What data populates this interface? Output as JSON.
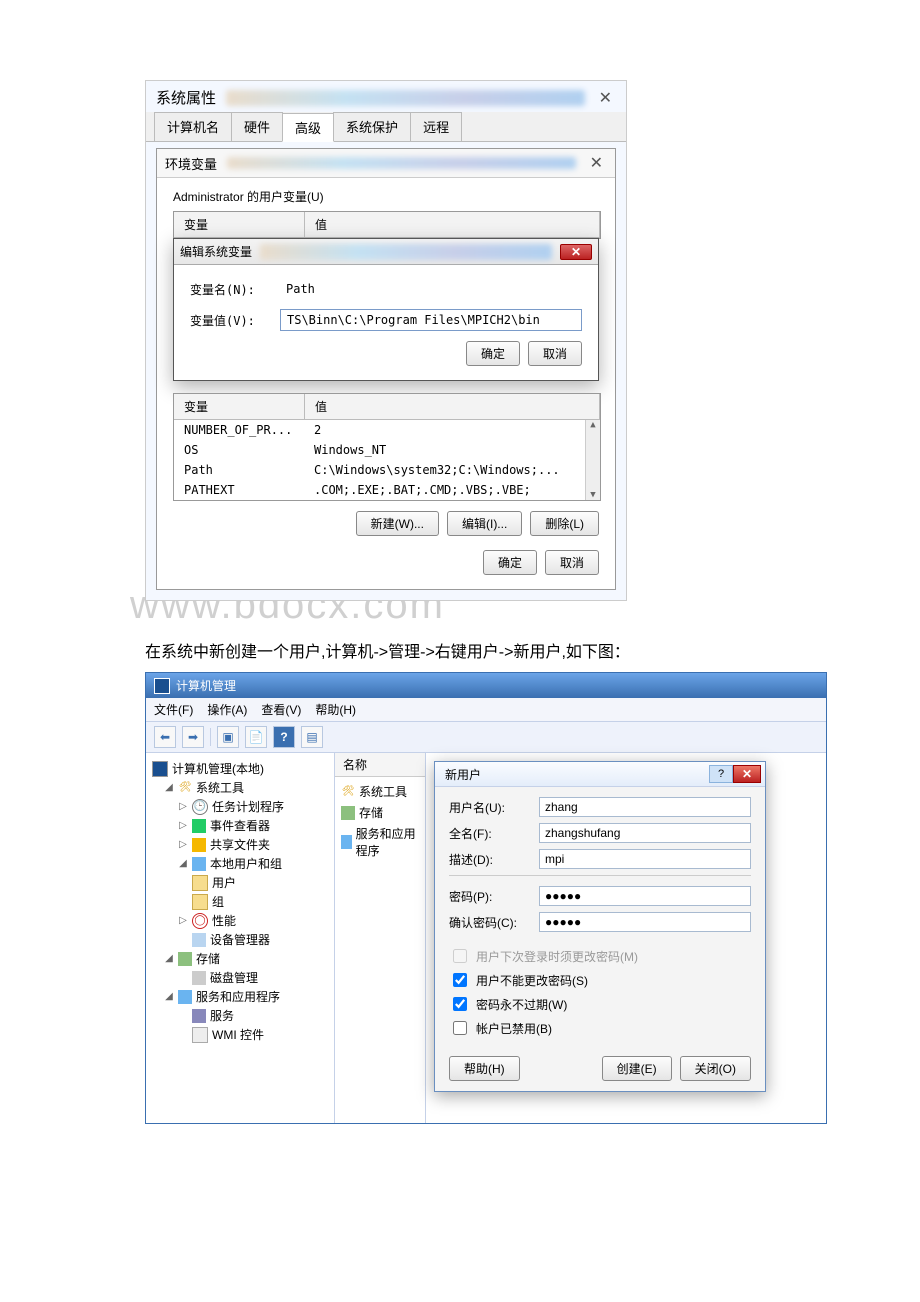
{
  "sysprops": {
    "title": "系统属性",
    "tabs": {
      "computer_name": "计算机名",
      "hardware": "硬件",
      "advanced": "高级",
      "protection": "系统保护",
      "remote": "远程"
    },
    "env": {
      "title": "环境变量",
      "user_section_label": "Administrator 的用户变量(U)",
      "col_var": "变量",
      "col_val": "值",
      "edit_title": "编辑系统变量",
      "var_name_label": "变量名(N):",
      "var_name_value": "Path",
      "var_value_label": "变量值(V):",
      "var_value_value": "TS\\Binn\\C:\\Program Files\\MPICH2\\bin",
      "ok": "确定",
      "cancel": "取消",
      "sys_col_var": "变量",
      "sys_col_val": "值",
      "sys_vars": [
        {
          "name": "NUMBER_OF_PR...",
          "value": "2"
        },
        {
          "name": "OS",
          "value": "Windows_NT"
        },
        {
          "name": "Path",
          "value": "C:\\Windows\\system32;C:\\Windows;..."
        },
        {
          "name": "PATHEXT",
          "value": ".COM;.EXE;.BAT;.CMD;.VBS;.VBE;"
        }
      ],
      "btn_new": "新建(W)...",
      "btn_edit": "编辑(I)...",
      "btn_del": "删除(L)"
    }
  },
  "watermark": "www.bdocx.com",
  "caption": "在系统中新创建一个用户,计算机->管理->右键用户->新用户,如下图：",
  "compmgmt": {
    "title": "计算机管理",
    "menus": {
      "file": "文件(F)",
      "action": "操作(A)",
      "view": "查看(V)",
      "help": "帮助(H)"
    },
    "tree": {
      "root": "计算机管理(本地)",
      "systools": "系统工具",
      "task": "任务计划程序",
      "eventv": "事件查看器",
      "shared": "共享文件夹",
      "lusers": "本地用户和组",
      "users": "用户",
      "groups": "组",
      "perf": "性能",
      "devmgr": "设备管理器",
      "storage": "存储",
      "diskmgr": "磁盘管理",
      "services_apps": "服务和应用程序",
      "services": "服务",
      "wmi": "WMI 控件"
    },
    "mid": {
      "hdr": "名称",
      "item1": "系统工具",
      "item2": "存储",
      "item3": "服务和应用程序"
    },
    "newuser": {
      "title": "新用户",
      "username_label": "用户名(U):",
      "username_value": "zhang",
      "fullname_label": "全名(F):",
      "fullname_value": "zhangshufang",
      "desc_label": "描述(D):",
      "desc_value": "mpi",
      "pwd_label": "密码(P):",
      "pwd_value": "●●●●●",
      "pwd2_label": "确认密码(C):",
      "pwd2_value": "●●●●●",
      "chk_change_next": "用户下次登录时须更改密码(M)",
      "chk_cannot_change": "用户不能更改密码(S)",
      "chk_never_expire": "密码永不过期(W)",
      "chk_disabled": "帐户已禁用(B)",
      "btn_help": "帮助(H)",
      "btn_create": "创建(E)",
      "btn_close": "关闭(O)"
    }
  }
}
